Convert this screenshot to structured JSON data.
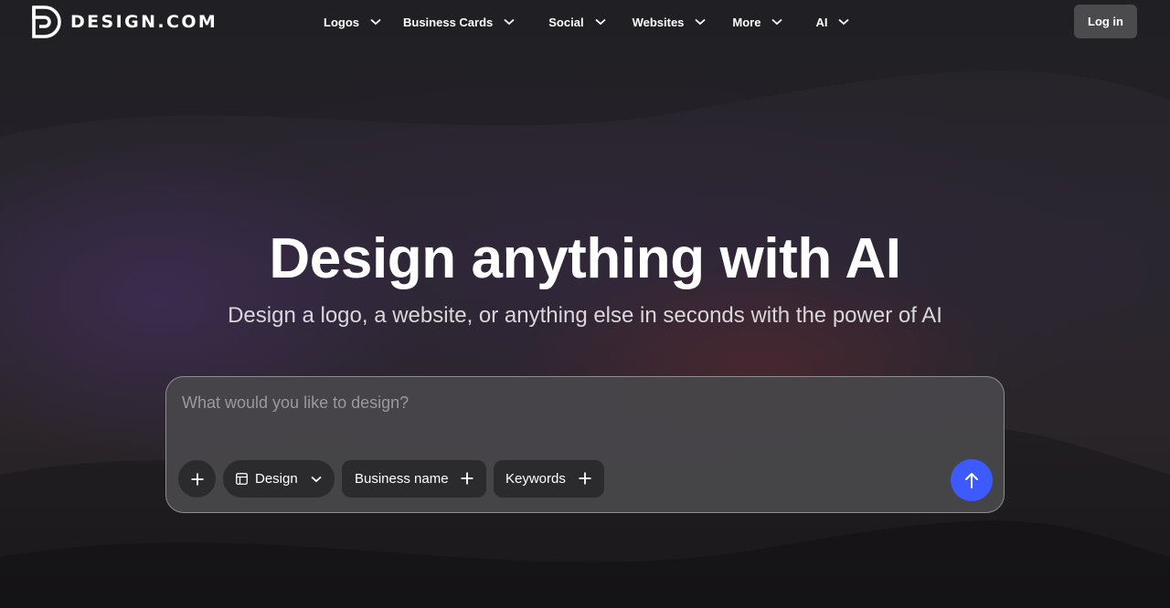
{
  "brand": {
    "name": "DESIGN.COM"
  },
  "nav": {
    "items": [
      {
        "label": "Logos"
      },
      {
        "label": "Business Cards"
      },
      {
        "label": "Social"
      },
      {
        "label": "Websites"
      },
      {
        "label": "More"
      },
      {
        "label": "AI"
      }
    ],
    "login_label": "Log in"
  },
  "hero": {
    "title": "Design anything with AI",
    "subtitle": "Design a logo, a website, or anything else in seconds with the power of AI"
  },
  "prompt": {
    "placeholder": "What would you like to design?",
    "value": "",
    "chips": {
      "type": "Design",
      "business_name": "Business name",
      "keywords": "Keywords"
    }
  },
  "icons": {
    "logo": "design-logo-icon",
    "menu_chevron": "chevron-down-icon",
    "add": "plus-icon",
    "type": "layout-grid-icon",
    "send": "arrow-up-icon"
  },
  "colors": {
    "send_button": "#3d5afe",
    "login_button": "#4b4b4d",
    "chip": "#2b2a2d",
    "prompt_box": "#48474a"
  }
}
